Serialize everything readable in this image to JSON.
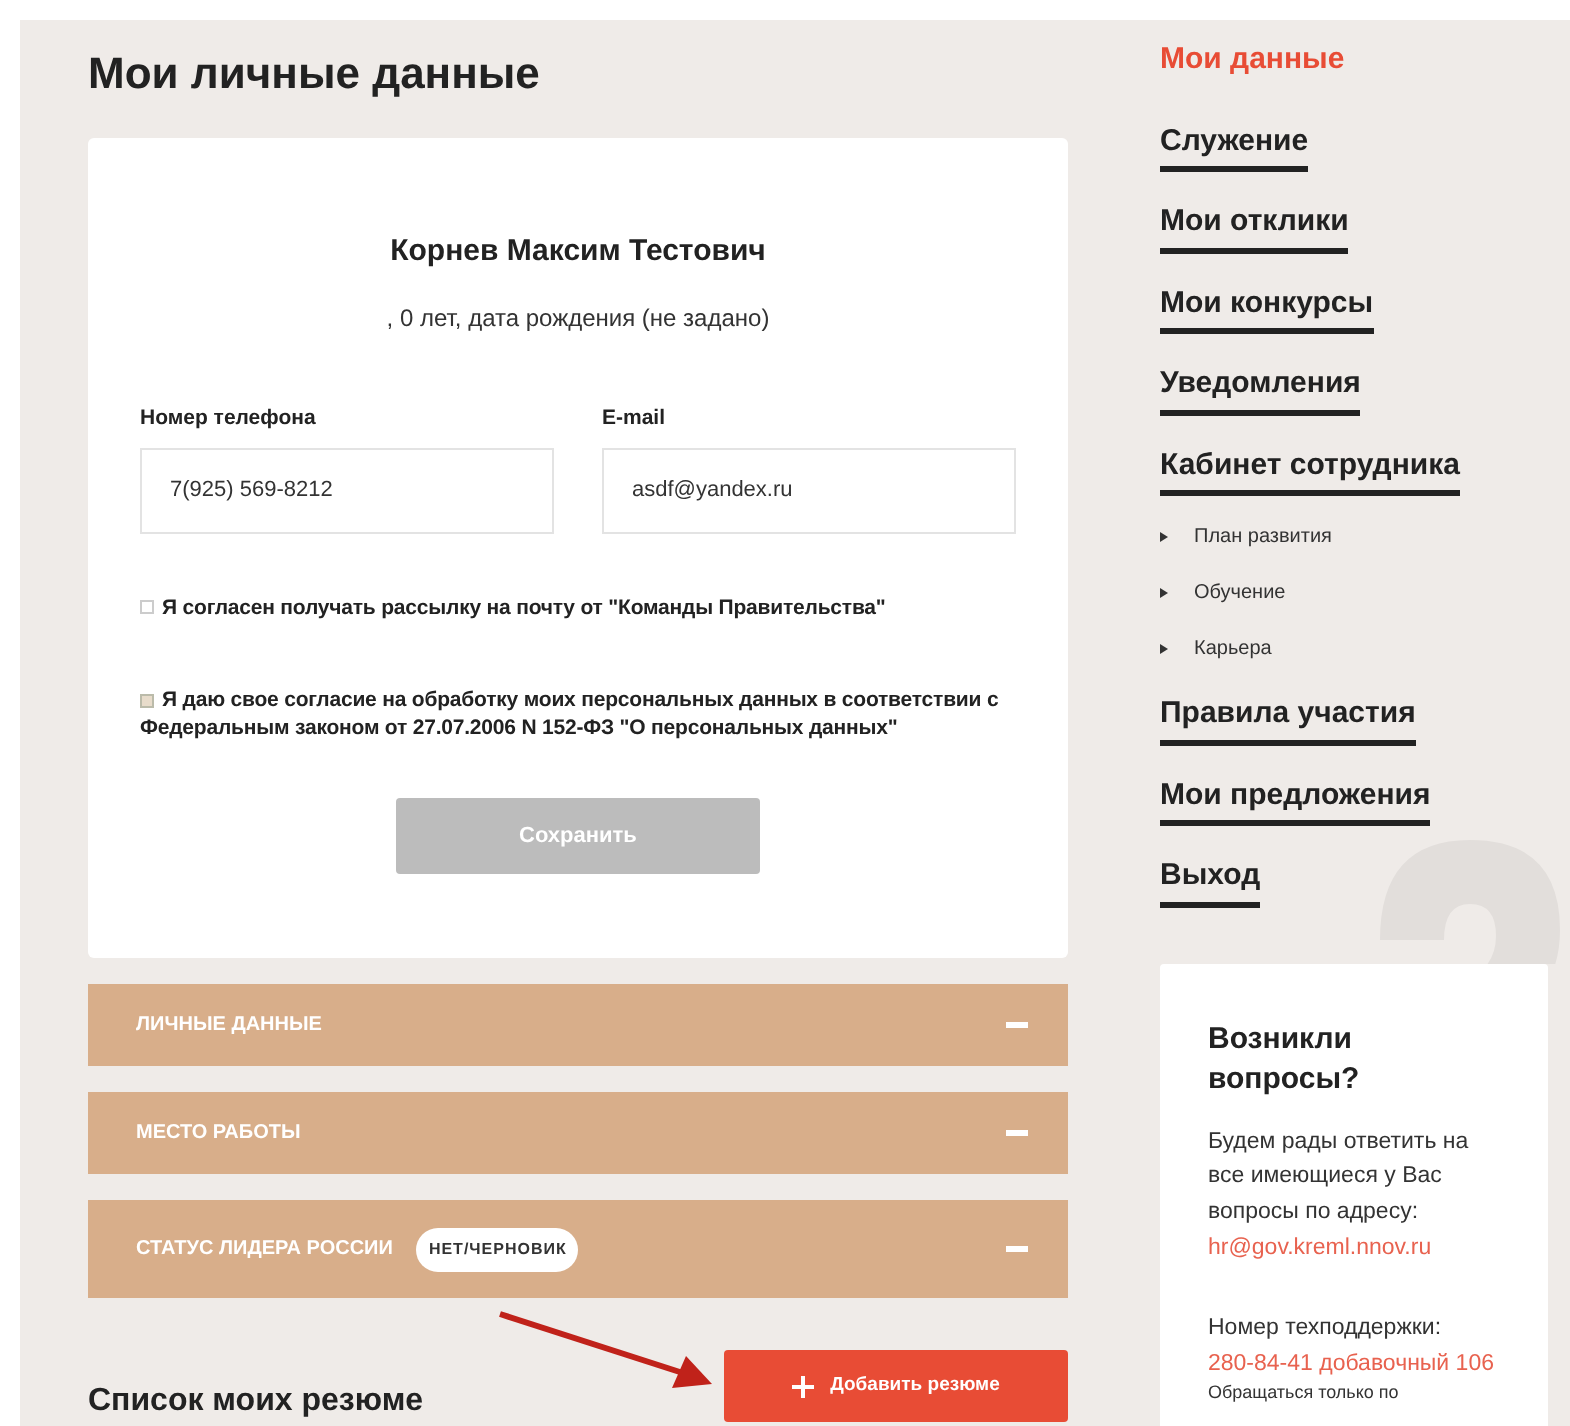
{
  "page_title": "Мои личные данные",
  "profile": {
    "name": "Корнев Максим Тестович",
    "subtitle": ", 0 лет, дата рождения (не задано)",
    "fields": [
      {
        "label": "Номер телефона",
        "value": "7(925) 569-8212"
      },
      {
        "label": "E-mail",
        "value": "asdf@yandex.ru"
      }
    ],
    "consents": [
      {
        "text": "Я согласен получать рассылку на почту от \"Команды Правительства\"",
        "checked": false
      },
      {
        "text": "Я даю свое согласие на обработку моих персональных данных в соответствии с Федеральным законом от 27.07.2006 N 152-ФЗ \"О персональных данных\"",
        "checked": true
      }
    ],
    "save_button": {
      "label": "Сохранить",
      "disabled": true
    }
  },
  "sections": [
    {
      "title": "ЛИЧНЫЕ ДАННЫЕ",
      "expanded": true
    },
    {
      "title": "МЕСТО РАБОТЫ",
      "expanded": true
    },
    {
      "title": "СТАТУС ЛИДЕРА РОССИИ",
      "badge": "НЕТ/ЧЕРНОВИК",
      "expanded": true
    }
  ],
  "resumes": {
    "title": "Список моих резюме",
    "add_button": "Добавить резюме"
  },
  "sidebar": {
    "items": [
      {
        "label": "Мои данные",
        "selected": true
      },
      {
        "label": "Служение",
        "selected": false
      },
      {
        "label": "Мои отклики",
        "selected": false
      },
      {
        "label": "Мои конкурсы",
        "selected": false
      },
      {
        "label": "Уведомления",
        "selected": false
      },
      {
        "label": "Кабинет сотрудника",
        "selected": false,
        "children": [
          {
            "label": "План развития"
          },
          {
            "label": "Обучение"
          },
          {
            "label": "Карьера"
          }
        ]
      },
      {
        "label": "Правила участия",
        "selected": false
      },
      {
        "label": "Мои предложения",
        "selected": false
      },
      {
        "label": "Выход",
        "selected": false
      }
    ]
  },
  "help": {
    "title": "Возникли вопросы?",
    "text": "Будем рады ответить на все имеющиеся у Вас вопросы по адресу:",
    "email": "hr@gov.kreml.nnov.ru",
    "phone_label": "Номер техподдержки:",
    "phone": "280-84-41 добавочный 106",
    "note": "Обращаться только по"
  }
}
